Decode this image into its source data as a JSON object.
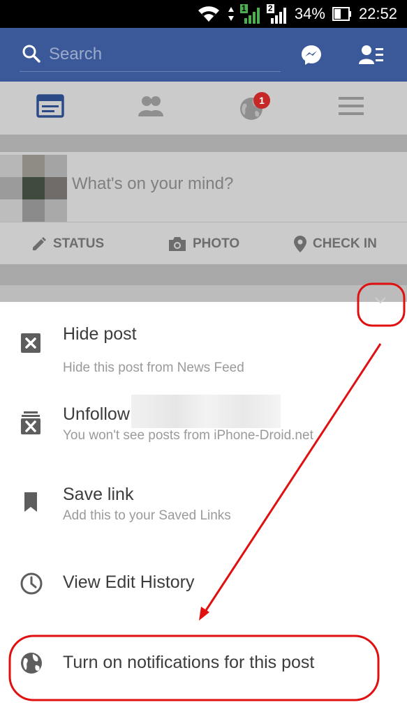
{
  "status_bar": {
    "sim1": "1",
    "sim2": "2",
    "battery": "34%",
    "time": "22:52"
  },
  "header": {
    "search_placeholder": "Search",
    "icons": [
      "search-icon",
      "messenger-icon",
      "friend-requests-icon"
    ],
    "color": "#3b5998"
  },
  "tabs": {
    "icons": [
      "news-feed-icon",
      "friends-icon",
      "notifications-globe-icon",
      "menu-icon"
    ],
    "notification_count": "1"
  },
  "composer": {
    "prompt": "What's on your mind?",
    "buttons": [
      {
        "label": "STATUS",
        "icon": "pencil-icon"
      },
      {
        "label": "PHOTO",
        "icon": "camera-icon"
      },
      {
        "label": "CHECK IN",
        "icon": "location-pin-icon"
      }
    ]
  },
  "menu": {
    "items": [
      {
        "title": "Hide post",
        "subtitle": "Hide this post from News Feed",
        "icon": "close-box-icon"
      },
      {
        "title": "Unfollow",
        "subtitle": "You won't see posts from iPhone-Droid.net",
        "icon": "unfollow-icon"
      },
      {
        "title": "Save link",
        "subtitle": "Add this to your Saved Links",
        "icon": "bookmark-icon"
      },
      {
        "title": "View Edit History",
        "subtitle": "",
        "icon": "clock-icon"
      },
      {
        "title": "Turn on notifications for this post",
        "subtitle": "",
        "icon": "globe-icon"
      }
    ]
  },
  "annotation": {
    "color": "#e01010"
  }
}
